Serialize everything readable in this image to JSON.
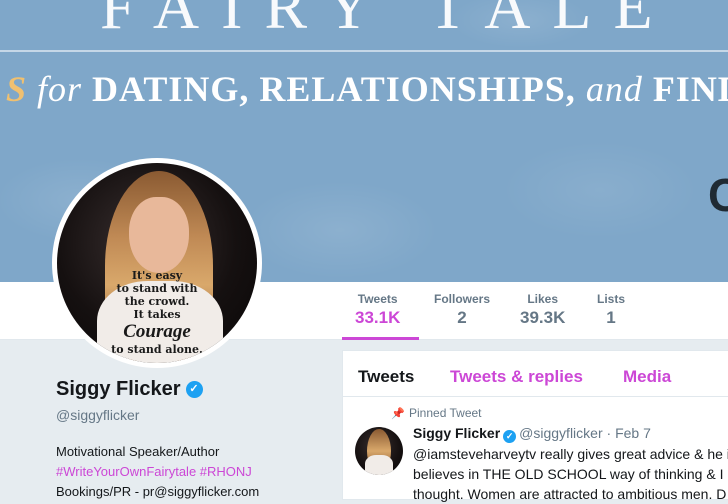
{
  "banner": {
    "title_fragment": "FAIRY TALE",
    "tagline_prefix": "S",
    "tagline": "for DATING, RELATIONSHIPS, and FINDING",
    "tagline_for": "for",
    "tagline_main": "DATING, RELATIONSHIPS,",
    "tagline_and": "and",
    "tagline_end": "FINDING",
    "corner_letter": "C"
  },
  "avatar_quote": {
    "line1": "It's easy",
    "line2": "to stand with",
    "line3": "the crowd.",
    "line4": "It takes",
    "line5": "Courage",
    "line6": "to stand alone."
  },
  "stats": [
    {
      "label": "Tweets",
      "value": "33.1K"
    },
    {
      "label": "Followers",
      "value": "2"
    },
    {
      "label": "Likes",
      "value": "39.3K"
    },
    {
      "label": "Lists",
      "value": "1"
    }
  ],
  "profile": {
    "name": "Siggy Flicker",
    "handle": "@siggyflicker",
    "bio_line1": "Motivational Speaker/Author",
    "hashtag1": "#WriteYourOwnFairytale",
    "hashtag2": "#RHONJ",
    "bio_line3": "Bookings/PR - pr@siggyflicker.com"
  },
  "tabs": [
    {
      "label": "Tweets"
    },
    {
      "label": "Tweets & replies"
    },
    {
      "label": "Media"
    }
  ],
  "tweet": {
    "pinned_label": "Pinned Tweet",
    "name": "Siggy Flicker",
    "handle": "@siggyflicker",
    "separator": "·",
    "date": "Feb 7",
    "line1": "@iamsteveharveytv really gives great advice & he is",
    "line2": "believes in THE OLD SCHOOL way of thinking & I ag",
    "line3": "thought. Women are attracted to ambitious men. D"
  },
  "colors": {
    "accent": "#cc47d6",
    "verified": "#1da1f2",
    "banner": "#7fa7c9"
  },
  "icons": {
    "verified": "verified-badge-icon",
    "pin": "pin-icon"
  }
}
